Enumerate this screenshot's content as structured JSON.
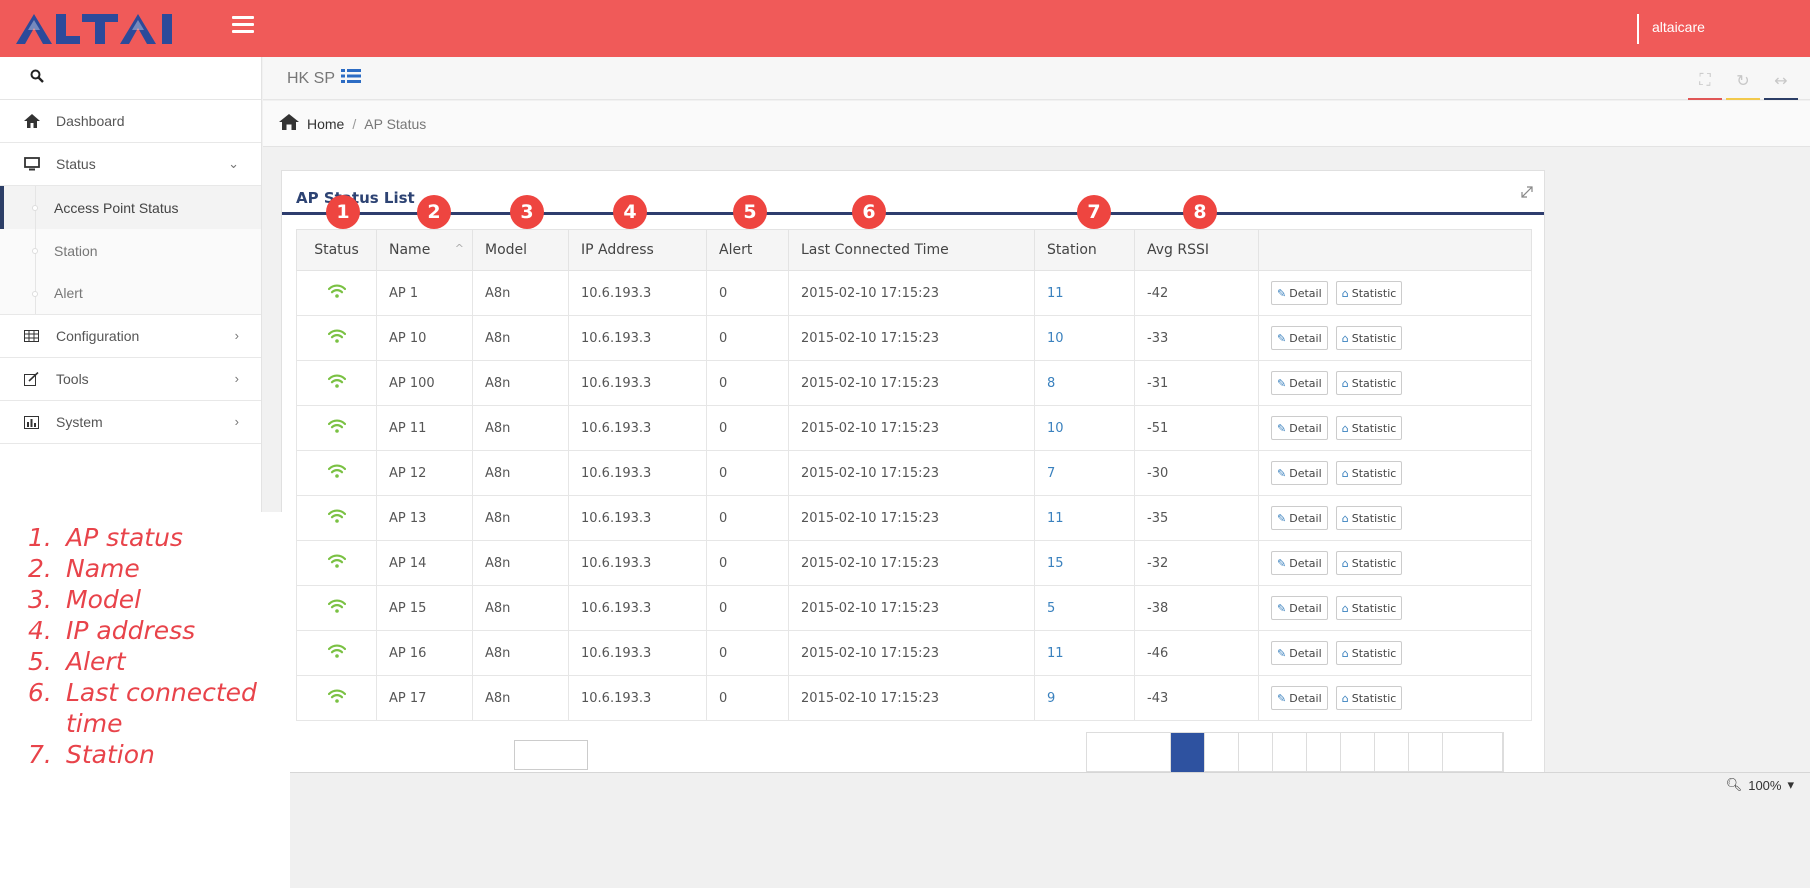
{
  "app": {
    "logo_text": "ALTAI",
    "username": "altaicare"
  },
  "header": {
    "site_name": "HK SP"
  },
  "breadcrumb": {
    "home": "Home",
    "separator": "/",
    "current": "AP Status"
  },
  "sidebar": {
    "items": [
      {
        "label": "Dashboard",
        "icon": "home-icon"
      },
      {
        "label": "Status",
        "icon": "monitor-icon",
        "expanded": true,
        "children": [
          {
            "label": "Access Point Status",
            "active": true
          },
          {
            "label": "Station"
          },
          {
            "label": "Alert"
          }
        ]
      },
      {
        "label": "Configuration",
        "icon": "grid-icon"
      },
      {
        "label": "Tools",
        "icon": "edit-icon"
      },
      {
        "label": "System",
        "icon": "bar-chart-icon"
      }
    ]
  },
  "panel": {
    "title": "AP Status List"
  },
  "badges": [
    "1",
    "2",
    "3",
    "4",
    "5",
    "6",
    "7",
    "8"
  ],
  "table": {
    "columns": [
      "Status",
      "Name",
      "Model",
      "IP Address",
      "Alert",
      "Last Connected Time",
      "Station",
      "Avg RSSI",
      ""
    ],
    "detail_label": "Detail",
    "statistic_label": "Statistic",
    "rows": [
      {
        "name": "AP 1",
        "model": "A8n",
        "ip": "10.6.193.3",
        "alert": "0",
        "time": "2015-02-10 17:15:23",
        "station": "11",
        "rssi": "-42"
      },
      {
        "name": "AP 10",
        "model": "A8n",
        "ip": "10.6.193.3",
        "alert": "0",
        "time": "2015-02-10 17:15:23",
        "station": "10",
        "rssi": "-33"
      },
      {
        "name": "AP 100",
        "model": "A8n",
        "ip": "10.6.193.3",
        "alert": "0",
        "time": "2015-02-10 17:15:23",
        "station": "8",
        "rssi": "-31"
      },
      {
        "name": "AP 11",
        "model": "A8n",
        "ip": "10.6.193.3",
        "alert": "0",
        "time": "2015-02-10 17:15:23",
        "station": "10",
        "rssi": "-51"
      },
      {
        "name": "AP 12",
        "model": "A8n",
        "ip": "10.6.193.3",
        "alert": "0",
        "time": "2015-02-10 17:15:23",
        "station": "7",
        "rssi": "-30"
      },
      {
        "name": "AP 13",
        "model": "A8n",
        "ip": "10.6.193.3",
        "alert": "0",
        "time": "2015-02-10 17:15:23",
        "station": "11",
        "rssi": "-35"
      },
      {
        "name": "AP 14",
        "model": "A8n",
        "ip": "10.6.193.3",
        "alert": "0",
        "time": "2015-02-10 17:15:23",
        "station": "15",
        "rssi": "-32"
      },
      {
        "name": "AP 15",
        "model": "A8n",
        "ip": "10.6.193.3",
        "alert": "0",
        "time": "2015-02-10 17:15:23",
        "station": "5",
        "rssi": "-38"
      },
      {
        "name": "AP 16",
        "model": "A8n",
        "ip": "10.6.193.3",
        "alert": "0",
        "time": "2015-02-10 17:15:23",
        "station": "11",
        "rssi": "-46"
      },
      {
        "name": "AP 17",
        "model": "A8n",
        "ip": "10.6.193.3",
        "alert": "0",
        "time": "2015-02-10 17:15:23",
        "station": "9",
        "rssi": "-43"
      }
    ]
  },
  "legend": [
    {
      "num": "1.",
      "text": "AP status"
    },
    {
      "num": "2.",
      "text": "Name"
    },
    {
      "num": "3.",
      "text": "Model"
    },
    {
      "num": "4.",
      "text": "IP address"
    },
    {
      "num": "5.",
      "text": "Alert"
    },
    {
      "num": "6.",
      "text": "Last connected time"
    },
    {
      "num": "7.",
      "text": "Station"
    }
  ],
  "zoom": "100%",
  "colors": {
    "topbar": "#f05a59",
    "accent_navy": "#2e3d6e",
    "badge": "#ee4540",
    "wifi": "#7ac143",
    "link": "#3a81be"
  }
}
